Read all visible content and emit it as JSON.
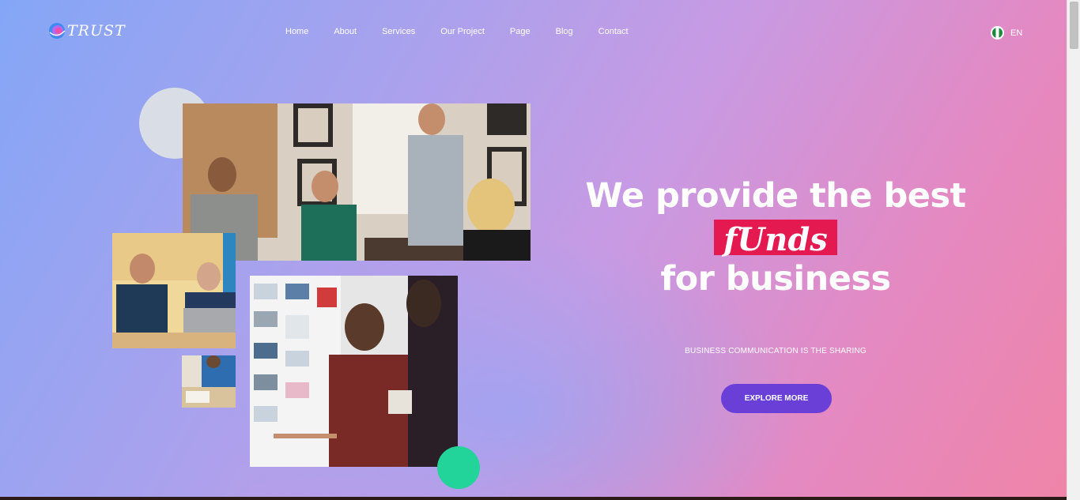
{
  "header": {
    "logo_text": "TRUST",
    "nav": [
      "Home",
      "About",
      "Services",
      "Our Project",
      "Page",
      "Blog",
      "Contact"
    ],
    "language": "EN"
  },
  "hero": {
    "line1": "We provide the best",
    "highlight": "fUnds",
    "line3": "for business",
    "subtitle": "BUSINESS COMMUNICATION IS THE SHARING",
    "cta_label": "EXPLORE MORE"
  },
  "colors": {
    "accent_button": "#6a3fd8",
    "highlight_bg": "#e3194f",
    "green_circle": "#22d39a",
    "gray_circle": "#d9dee6"
  }
}
